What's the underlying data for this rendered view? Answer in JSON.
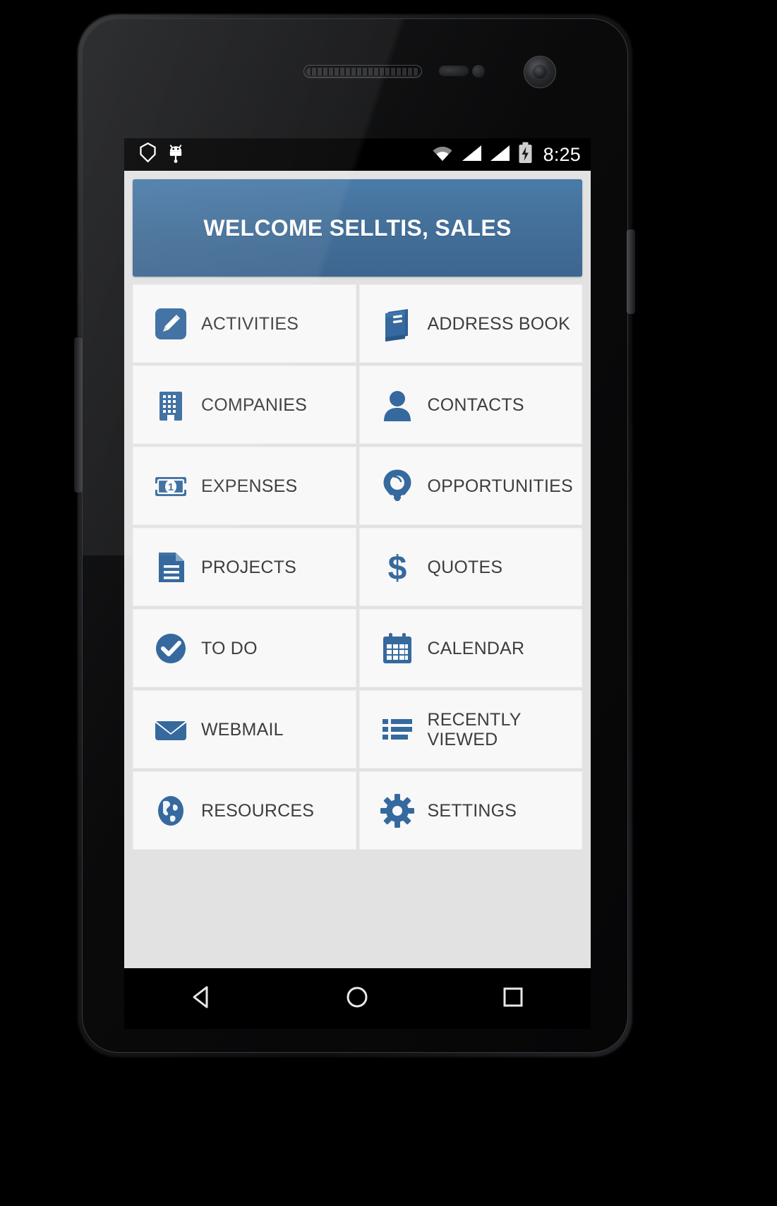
{
  "device": {
    "type": "android-phone",
    "hardware": {
      "earpiece_speaker": "speaker-grille",
      "proximity_sensor": "proximity-sensor",
      "light_sensor": "light-sensor",
      "front_camera": "front-camera",
      "volume_button": "volume-rocker",
      "power_button": "power-button"
    }
  },
  "statusbar": {
    "time": "8:25",
    "left_icons": [
      "shield-icon",
      "android-debug-icon"
    ],
    "right_icons": [
      "wifi-icon",
      "signal-icon-1",
      "signal-icon-2",
      "battery-charging-icon"
    ],
    "background": "#000000"
  },
  "header": {
    "title": "WELCOME SELLTIS, SALES",
    "background": "#436F99",
    "text_color": "#FFFFFF"
  },
  "theme": {
    "accent": "#36699E",
    "tile_background": "#F8F8F8",
    "page_background": "#E2E2E2",
    "label_color": "#3D3D3D"
  },
  "menu": {
    "tiles": [
      {
        "label": "ACTIVITIES",
        "icon": "pencil-square-icon"
      },
      {
        "label": "ADDRESS BOOK",
        "icon": "address-book-icon"
      },
      {
        "label": "COMPANIES",
        "icon": "building-icon"
      },
      {
        "label": "CONTACTS",
        "icon": "person-icon"
      },
      {
        "label": "EXPENSES",
        "icon": "banknote-icon"
      },
      {
        "label": "OPPORTUNITIES",
        "icon": "lightbulb-icon"
      },
      {
        "label": "PROJECTS",
        "icon": "document-icon"
      },
      {
        "label": "QUOTES",
        "icon": "dollar-sign-icon"
      },
      {
        "label": "TO DO",
        "icon": "check-circle-icon"
      },
      {
        "label": "CALENDAR",
        "icon": "calendar-icon"
      },
      {
        "label": "WEBMAIL",
        "icon": "envelope-icon"
      },
      {
        "label": "RECENTLY\nVIEWED",
        "icon": "list-icon",
        "line1": "RECENTLY",
        "line2": "VIEWED"
      },
      {
        "label": "RESOURCES",
        "icon": "globe-icon"
      },
      {
        "label": "SETTINGS",
        "icon": "gear-icon"
      }
    ]
  },
  "navbar": {
    "buttons": [
      {
        "name": "back",
        "icon": "back-triangle-icon"
      },
      {
        "name": "home",
        "icon": "home-circle-icon"
      },
      {
        "name": "recents",
        "icon": "recents-square-icon"
      }
    ],
    "background": "#000000"
  }
}
